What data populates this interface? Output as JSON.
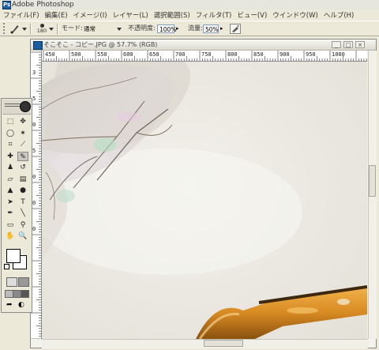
{
  "titlebar": {
    "title": "Adobe Photoshop"
  },
  "menu": [
    "ファイル(F)",
    "編集(E)",
    "イメージ(I)",
    "レイヤー(L)",
    "選択範囲(S)",
    "フィルタ(T)",
    "ビュー(V)",
    "ウインドウ(W)",
    "ヘルプ(H)"
  ],
  "options": {
    "brush_size": "180",
    "mode_label": "モード:",
    "mode_value": "通常",
    "opacity_label": "不透明度:",
    "opacity_value": "100%",
    "flow_label": "流量:",
    "flow_value": "50%"
  },
  "document": {
    "title": "そこそこ - コピー.JPG @ 57.7% (RGB)",
    "ruler_top": [
      "450",
      "500",
      "550",
      "600",
      "650",
      "700",
      "750",
      "800",
      "850",
      "900",
      "950",
      "1000"
    ],
    "ruler_left": [
      "3",
      "5",
      "0",
      "5",
      "0",
      "0",
      "0"
    ]
  },
  "tools": [
    "marquee-tool",
    "move-tool",
    "lasso-tool",
    "magic-wand-tool",
    "crop-tool",
    "slice-tool",
    "healing-brush-tool",
    "brush-tool",
    "clone-stamp-tool",
    "history-brush-tool",
    "eraser-tool",
    "gradient-tool",
    "blur-tool",
    "dodge-tool",
    "path-selection-tool",
    "type-tool",
    "pen-tool",
    "line-tool",
    "notes-tool",
    "eyedropper-tool",
    "hand-tool",
    "zoom-tool"
  ],
  "colors": {
    "foreground": "#ffffff",
    "background": "#ffffff",
    "stem_orange": "#d88a22",
    "stem_dark": "#3e2810",
    "photo_bg": "#e9e6df"
  }
}
